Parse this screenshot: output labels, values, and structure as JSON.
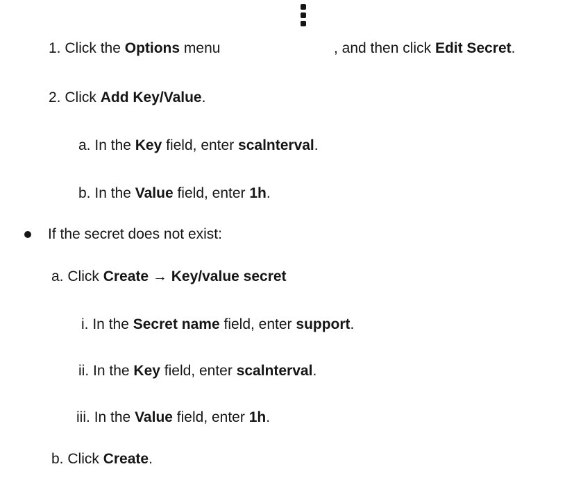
{
  "steps": {
    "s1": {
      "num": "1.",
      "pre": "Click the",
      "options": "Options",
      "menu": "menu",
      "post": ", and then click",
      "edit_secret": "Edit Secret",
      "end": "."
    },
    "s2": {
      "num": "2.",
      "pre": "Click",
      "add_kv": "Add Key/Value",
      "end": "."
    },
    "s2a": {
      "num": "a.",
      "pre": "In the",
      "key": "Key",
      "mid": "field, enter",
      "value": "scalnterval",
      "end": "."
    },
    "s2b": {
      "num": "b.",
      "pre": "In the",
      "field": "Value",
      "mid": "field, enter",
      "value": "1h",
      "end": "."
    }
  },
  "bullet": {
    "text": "If the secret does not exist:"
  },
  "sub": {
    "a": {
      "num": "a.",
      "pre": "Click",
      "create": "Create",
      "arrow": "→",
      "kv_secret": "Key/value secret"
    },
    "i": {
      "num": "i.",
      "pre": "In the",
      "field": "Secret name",
      "mid": "field, enter",
      "value": "support",
      "end": "."
    },
    "ii": {
      "num": "ii.",
      "pre": "In the",
      "field": "Key",
      "mid": "field, enter",
      "value": "scalnterval",
      "end": "."
    },
    "iii": {
      "num": "iii.",
      "pre": "In the",
      "field": "Value",
      "mid": "field, enter",
      "value": "1h",
      "end": "."
    },
    "b": {
      "num": "b.",
      "pre": "Click",
      "create": "Create",
      "end": "."
    }
  },
  "icons": {
    "options_icon": "kebab-vertical-icon",
    "bullet_icon": "bullet-dot"
  }
}
